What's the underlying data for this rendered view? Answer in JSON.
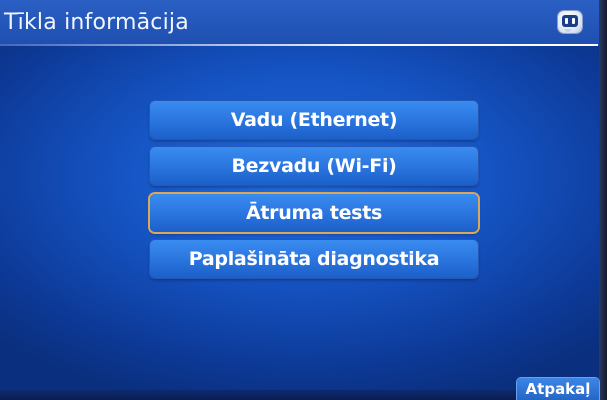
{
  "header": {
    "title": "Tīkla informācija",
    "info_icon": "info-speech-icon"
  },
  "menu": {
    "items": [
      {
        "label": "Vadu (Ethernet)",
        "focused": false
      },
      {
        "label": "Bezvadu (Wi-Fi)",
        "focused": false
      },
      {
        "label": "Ātruma tests",
        "focused": true
      },
      {
        "label": "Paplašināta diagnostika",
        "focused": false
      }
    ]
  },
  "footer": {
    "back_label": "Atpakaļ"
  },
  "colors": {
    "background": "#1553c2",
    "button": "#2b76e0",
    "focus_outline": "#d9a85a"
  }
}
